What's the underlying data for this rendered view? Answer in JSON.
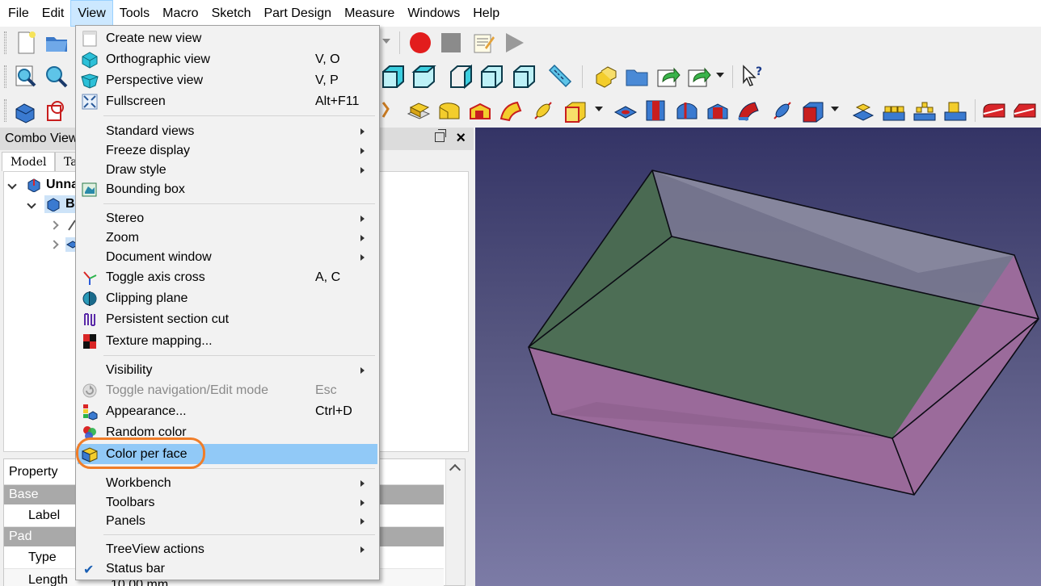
{
  "menubar": {
    "items": [
      "File",
      "Edit",
      "View",
      "Tools",
      "Macro",
      "Sketch",
      "Part Design",
      "Measure",
      "Windows",
      "Help"
    ],
    "active_index": 2
  },
  "combo_view": {
    "title": "Combo View",
    "tabs": [
      "Model",
      "Ta"
    ],
    "tree": {
      "root_label": "Unna",
      "body_label": "B"
    }
  },
  "property_panel": {
    "header": "Property",
    "groups": [
      {
        "name": "Base",
        "rows": [
          "Label"
        ]
      },
      {
        "name": "Pad",
        "rows": [
          "Type",
          "Length"
        ]
      }
    ],
    "length_value_partial": "10.00 mm"
  },
  "view_menu": {
    "items": [
      {
        "label": "Create new view",
        "shortcut": "",
        "submenu": false,
        "icon": "new-view-icon"
      },
      {
        "label": "Orthographic view",
        "shortcut": "V, O",
        "submenu": false,
        "icon": "orthographic-cube-icon"
      },
      {
        "label": "Perspective view",
        "shortcut": "V, P",
        "submenu": false,
        "icon": "perspective-cube-icon"
      },
      {
        "label": "Fullscreen",
        "shortcut": "Alt+F11",
        "submenu": false,
        "icon": "fullscreen-icon"
      },
      {
        "label": "Standard views",
        "shortcut": "",
        "submenu": true
      },
      {
        "label": "Freeze display",
        "shortcut": "",
        "submenu": true
      },
      {
        "label": "Draw style",
        "shortcut": "",
        "submenu": true
      },
      {
        "label": "Bounding box",
        "shortcut": "",
        "submenu": false,
        "icon": "bounding-box-icon"
      },
      {
        "label": "Stereo",
        "shortcut": "",
        "submenu": true
      },
      {
        "label": "Zoom",
        "shortcut": "",
        "submenu": true
      },
      {
        "label": "Document window",
        "shortcut": "",
        "submenu": true
      },
      {
        "label": "Toggle axis cross",
        "shortcut": "A, C",
        "submenu": false,
        "icon": "axis-cross-icon"
      },
      {
        "label": "Clipping plane",
        "shortcut": "",
        "submenu": false,
        "icon": "clipping-plane-icon"
      },
      {
        "label": "Persistent section cut",
        "shortcut": "",
        "submenu": false,
        "icon": "section-cut-icon"
      },
      {
        "label": "Texture mapping...",
        "shortcut": "",
        "submenu": false,
        "icon": "texture-icon"
      },
      {
        "label": "Visibility",
        "shortcut": "",
        "submenu": true
      },
      {
        "label": "Toggle navigation/Edit mode",
        "shortcut": "Esc",
        "submenu": false,
        "disabled": true,
        "icon": "navigation-icon"
      },
      {
        "label": "Appearance...",
        "shortcut": "Ctrl+D",
        "submenu": false,
        "icon": "appearance-icon"
      },
      {
        "label": "Random color",
        "shortcut": "",
        "submenu": false,
        "icon": "random-color-icon"
      },
      {
        "label": "Color per face",
        "shortcut": "",
        "submenu": false,
        "highlighted": true,
        "icon": "color-per-face-icon"
      },
      {
        "label": "Workbench",
        "shortcut": "",
        "submenu": true
      },
      {
        "label": "Toolbars",
        "shortcut": "",
        "submenu": true
      },
      {
        "label": "Panels",
        "shortcut": "",
        "submenu": true
      },
      {
        "label": "TreeView actions",
        "shortcut": "",
        "submenu": true
      },
      {
        "label": "Status bar",
        "shortcut": "",
        "submenu": false,
        "checked": true
      }
    ]
  },
  "colors": {
    "menu_highlight": "#91c9f7",
    "annotation_ring": "#f07d28",
    "view_bg_top": "#343466",
    "view_bg_bottom": "#7c7ba6",
    "box_top_face": "#4d6e55",
    "box_side_face": "#9a6a9a"
  }
}
